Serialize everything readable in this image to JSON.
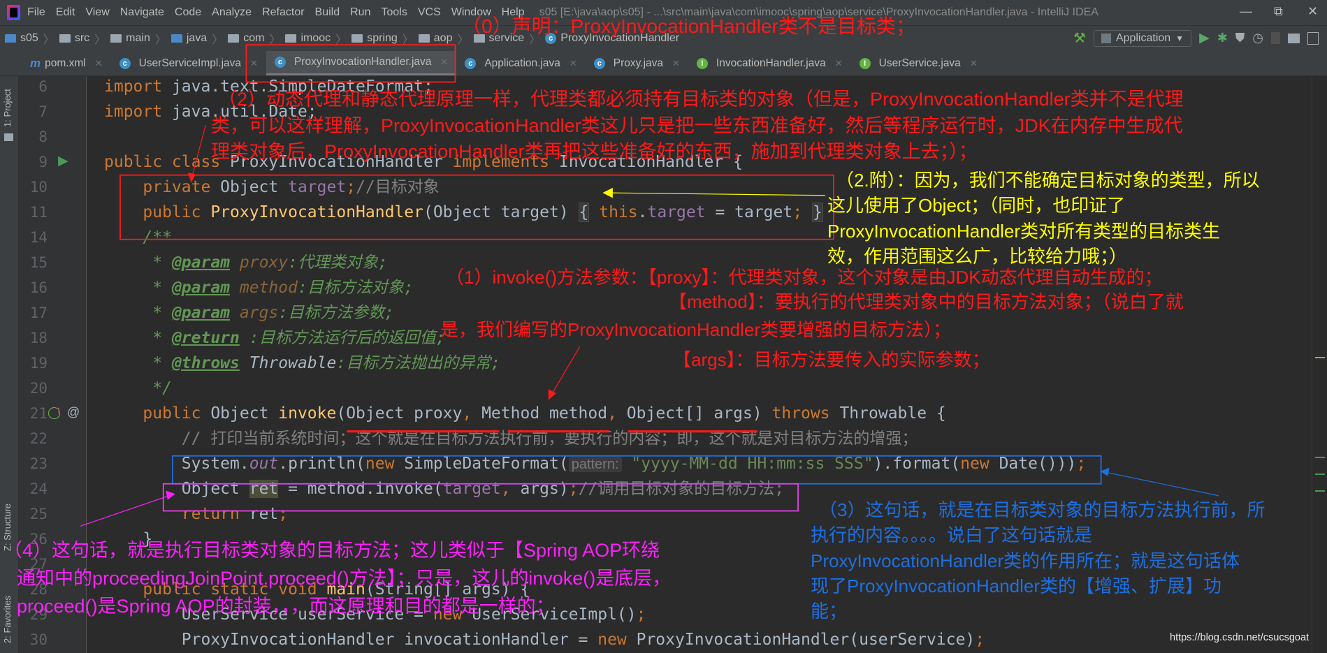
{
  "menubar": {
    "items": [
      "File",
      "Edit",
      "View",
      "Navigate",
      "Code",
      "Analyze",
      "Refactor",
      "Build",
      "Run",
      "Tools",
      "VCS",
      "Window",
      "Help"
    ],
    "title": "s05 [E:\\java\\aop\\s05] - ...\\src\\main\\java\\com\\imooc\\spring\\aop\\service\\ProxyInvocationHandler.java - IntelliJ IDEA"
  },
  "breadcrumb": [
    "s05",
    "src",
    "main",
    "java",
    "com",
    "imooc",
    "spring",
    "aop",
    "service",
    "ProxyInvocationHandler"
  ],
  "toolbar": {
    "run_config": "Application"
  },
  "tabs": [
    {
      "label": "pom.xml",
      "icon": "maven-icon"
    },
    {
      "label": "UserServiceImpl.java",
      "icon": "class-icon"
    },
    {
      "label": "ProxyInvocationHandler.java",
      "icon": "class-icon",
      "active": true
    },
    {
      "label": "Application.java",
      "icon": "class-icon"
    },
    {
      "label": "Proxy.java",
      "icon": "class-icon"
    },
    {
      "label": "InvocationHandler.java",
      "icon": "interface-icon"
    },
    {
      "label": "UserService.java",
      "icon": "interface-icon"
    }
  ],
  "side_panels": {
    "project": "1: Project",
    "structure": "Z: Structure",
    "favorites": "2: Favorites"
  },
  "code": {
    "lines": [
      {
        "n": "6",
        "tokens": [
          [
            "import ",
            "kw"
          ],
          [
            "java.text.SimpleDateFormat;",
            "pl"
          ]
        ]
      },
      {
        "n": "7",
        "tokens": [
          [
            "import ",
            "kw"
          ],
          [
            "java.util.Date;",
            "pl"
          ]
        ]
      },
      {
        "n": "8",
        "tokens": []
      },
      {
        "n": "9",
        "tokens": [
          [
            "public class ",
            "kw"
          ],
          [
            "ProxyInvocationHandler ",
            "pl"
          ],
          [
            "implements ",
            "kw"
          ],
          [
            "InvocationHandler {",
            "pl"
          ]
        ]
      },
      {
        "n": "10",
        "tokens": [
          [
            "    private ",
            "kw"
          ],
          [
            "Object ",
            "pl"
          ],
          [
            "target",
            "fd"
          ],
          [
            ";",
            "kw"
          ],
          [
            "//目标对象",
            "cm"
          ]
        ]
      },
      {
        "n": "11",
        "tokens": [
          [
            "    public ",
            "kw"
          ],
          [
            "ProxyInvocationHandler",
            "mt"
          ],
          [
            "(Object target) ",
            "pl"
          ],
          [
            "{",
            "fo"
          ],
          [
            " ",
            "pl"
          ],
          [
            "this",
            "kw"
          ],
          [
            ".",
            "pl"
          ],
          [
            "target",
            "fd"
          ],
          [
            " = target",
            "pl"
          ],
          [
            ";",
            "kw"
          ],
          [
            " ",
            "pl"
          ],
          [
            "}",
            "fo"
          ]
        ]
      },
      {
        "n": "14",
        "tokens": [
          [
            "    /**",
            "dc"
          ]
        ]
      },
      {
        "n": "15",
        "tokens": [
          [
            "     * ",
            "dc"
          ],
          [
            "@param",
            "dt"
          ],
          [
            " ",
            "dc"
          ],
          [
            "proxy",
            "dp"
          ],
          [
            ":代理类对象;",
            "dc"
          ]
        ]
      },
      {
        "n": "16",
        "tokens": [
          [
            "     * ",
            "dc"
          ],
          [
            "@param",
            "dt"
          ],
          [
            " ",
            "dc"
          ],
          [
            "method",
            "dp"
          ],
          [
            ":目标方法对象;",
            "dc"
          ]
        ]
      },
      {
        "n": "17",
        "tokens": [
          [
            "     * ",
            "dc"
          ],
          [
            "@param",
            "dt"
          ],
          [
            " ",
            "dc"
          ],
          [
            "args",
            "dp"
          ],
          [
            ":目标方法参数;",
            "dc"
          ]
        ]
      },
      {
        "n": "18",
        "tokens": [
          [
            "     * ",
            "dc"
          ],
          [
            "@return",
            "dt"
          ],
          [
            " :目标方法运行后的返回值;",
            "dc"
          ]
        ]
      },
      {
        "n": "19",
        "tokens": [
          [
            "     * ",
            "dc"
          ],
          [
            "@throws",
            "dt"
          ],
          [
            " ",
            "dc"
          ],
          [
            "Throwable",
            "dti"
          ],
          [
            ":目标方法抛出的异常;",
            "dc"
          ]
        ]
      },
      {
        "n": "20",
        "tokens": [
          [
            "     */",
            "dc"
          ]
        ]
      },
      {
        "n": "21",
        "tokens": [
          [
            "    public ",
            "kw"
          ],
          [
            "Object ",
            "pl"
          ],
          [
            "invoke",
            "mt"
          ],
          [
            "(Object proxy",
            "pl"
          ],
          [
            ", ",
            "kw"
          ],
          [
            "Method method",
            "pl"
          ],
          [
            ", ",
            "kw"
          ],
          [
            "Object[] args) ",
            "pl"
          ],
          [
            "throws ",
            "kw"
          ],
          [
            "Throwable {",
            "pl"
          ]
        ]
      },
      {
        "n": "22",
        "tokens": [
          [
            "        // 打印当前系统时间；这个就是在目标方法执行前，要执行的内容；即，这个就是对目标方法的增强；",
            "cm"
          ]
        ]
      },
      {
        "n": "23",
        "tokens": [
          [
            "        System.",
            "pl"
          ],
          [
            "out",
            "sf"
          ],
          [
            ".println(",
            "pl"
          ],
          [
            "new ",
            "kw"
          ],
          [
            "SimpleDateFormat(",
            "pl"
          ],
          [
            "pattern:",
            "hn"
          ],
          [
            " ",
            "pl"
          ],
          [
            "\"yyyy-MM-dd HH:mm:ss SSS\"",
            "st"
          ],
          [
            ").format(",
            "pl"
          ],
          [
            "new ",
            "kw"
          ],
          [
            "Date()))",
            "pl"
          ],
          [
            ";",
            "kw"
          ]
        ]
      },
      {
        "n": "24",
        "tokens": [
          [
            "        Object ",
            "pl"
          ],
          [
            "ret",
            "hl"
          ],
          [
            " = method.invoke(",
            "pl"
          ],
          [
            "target",
            "fd"
          ],
          [
            ", ",
            "kw"
          ],
          [
            "args)",
            "pl"
          ],
          [
            ";",
            "kw"
          ],
          [
            "//调用目标对象的目标方法;",
            "cm"
          ]
        ]
      },
      {
        "n": "25",
        "tokens": [
          [
            "        return ",
            "kw"
          ],
          [
            "ret",
            "pl"
          ],
          [
            ";",
            "kw"
          ]
        ]
      },
      {
        "n": "26",
        "tokens": [
          [
            "    }",
            "pl"
          ]
        ]
      },
      {
        "n": "27",
        "tokens": []
      },
      {
        "n": "28",
        "tokens": [
          [
            "    public static void ",
            "kw"
          ],
          [
            "main",
            "mt"
          ],
          [
            "(String[] args) {",
            "pl"
          ]
        ]
      },
      {
        "n": "29",
        "tokens": [
          [
            "        UserService userService = ",
            "pl"
          ],
          [
            "new ",
            "kw"
          ],
          [
            "UserServiceImpl()",
            "pl"
          ],
          [
            ";",
            "kw"
          ]
        ]
      },
      {
        "n": "30",
        "tokens": [
          [
            "        ProxyInvocationHandler invocationHandler = ",
            "pl"
          ],
          [
            "new ",
            "kw"
          ],
          [
            "ProxyInvocationHandler(userService)",
            "pl"
          ],
          [
            ";",
            "kw"
          ]
        ]
      }
    ]
  },
  "annotations": {
    "a0": "（0）声明：ProxyInvocationHandler类不是目标类；",
    "a2": [
      "（2）动态代理和静态代理原理一样，代理类都必须持有目标类的对象（但是，ProxyInvocationHandler类并不是代理",
      "类，可以这样理解，ProxyInvocationHandler类这儿只是把一些东西准备好，然后等程序运行时，JDK在内存中生成代",
      "理类对象后，ProxyInvocationHandler类再把这些准备好的东西，施加到代理类对象上去；）；"
    ],
    "a2_note": [
      "（2.附）：因为，我们不能确定目标对象的类型，所以",
      "这儿使用了Object；（同时，也印证了",
      "ProxyInvocationHandler类对所有类型的目标类生",
      "效，作用范围这么广，比较给力哦；）"
    ],
    "a1": [
      "（1）invoke()方法参数：【proxy】：代理类对象，这个对象是由JDK动态代理自动生成的；",
      "【method】：要执行的代理类对象中的目标方法对象；（说白了就",
      "是，我们编写的ProxyInvocationHandler类要增强的目标方法）；",
      "【args】：目标方法要传入的实际参数；"
    ],
    "a3": [
      "（3）这句话，就是在目标类对象的目标方法执行前，所",
      "执行的内容。。。。说白了这句话就是",
      "ProxyInvocationHandler类的作用所在；就是这句话体",
      "现了ProxyInvocationHandler类的【增强、扩展】功",
      "能；"
    ],
    "a4": [
      "（4）这句话，就是执行目标类对象的目标方法；这儿类似于【Spring AOP环绕",
      "通知中的proceedingJoinPoint.proceed()方法】；只是，这儿的invoke()是底层，",
      "proceed()是Spring AOP的封装，，，而这原理和目的都是一样的；"
    ]
  },
  "watermark": "https://blog.csdn.net/csucsgoat",
  "colors": {
    "annot_red": "#ff1a1a",
    "annot_yellow": "#ffff00",
    "annot_blue": "#1e6fe0",
    "annot_magenta": "#ff20ff",
    "editor_bg": "#2b2b2b"
  }
}
